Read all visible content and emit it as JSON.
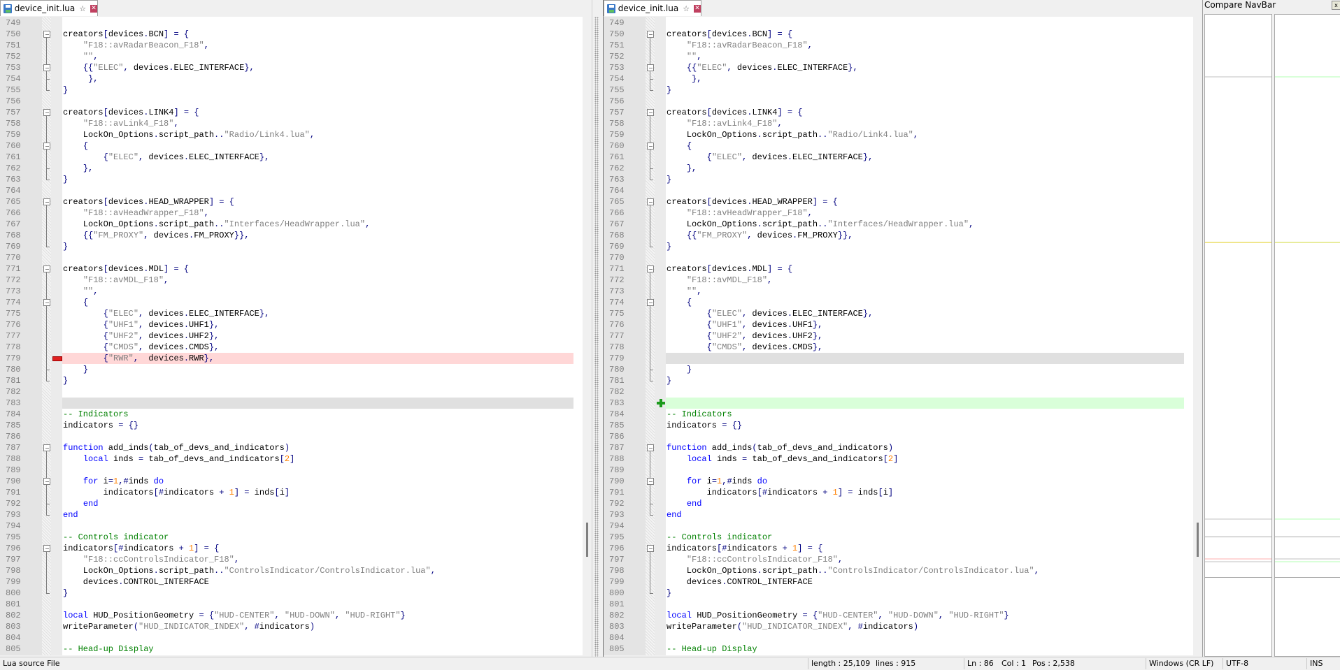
{
  "left": {
    "tab": {
      "title": "device_init.lua",
      "icons": [
        "save-icon",
        "pin-icon",
        "close-icon"
      ]
    },
    "lines": [
      {
        "n": "749",
        "t": ""
      },
      {
        "n": "750",
        "t": "creators[devices.BCN] = {"
      },
      {
        "n": "751",
        "t": "    \"F18::avRadarBeacon_F18\","
      },
      {
        "n": "752",
        "t": "    \"\","
      },
      {
        "n": "753",
        "t": "    {{\"ELEC\", devices.ELEC_INTERFACE},"
      },
      {
        "n": "754",
        "t": "     },"
      },
      {
        "n": "755",
        "t": "}"
      },
      {
        "n": "756",
        "t": ""
      },
      {
        "n": "757",
        "t": "creators[devices.LINK4] = {"
      },
      {
        "n": "758",
        "t": "    \"F18::avLink4_F18\","
      },
      {
        "n": "759",
        "t": "    LockOn_Options.script_path..\"Radio/Link4.lua\","
      },
      {
        "n": "760",
        "t": "    {"
      },
      {
        "n": "761",
        "t": "        {\"ELEC\", devices.ELEC_INTERFACE},"
      },
      {
        "n": "762",
        "t": "    },"
      },
      {
        "n": "763",
        "t": "}"
      },
      {
        "n": "764",
        "t": ""
      },
      {
        "n": "765",
        "t": "creators[devices.HEAD_WRAPPER] = {"
      },
      {
        "n": "766",
        "t": "    \"F18::avHeadWrapper_F18\","
      },
      {
        "n": "767",
        "t": "    LockOn_Options.script_path..\"Interfaces/HeadWrapper.lua\","
      },
      {
        "n": "768",
        "t": "    {{\"FM_PROXY\", devices.FM_PROXY}},"
      },
      {
        "n": "769",
        "t": "}"
      },
      {
        "n": "770",
        "t": ""
      },
      {
        "n": "771",
        "t": "creators[devices.MDL] = {"
      },
      {
        "n": "772",
        "t": "    \"F18::avMDL_F18\","
      },
      {
        "n": "773",
        "t": "    \"\","
      },
      {
        "n": "774",
        "t": "    {"
      },
      {
        "n": "775",
        "t": "        {\"ELEC\", devices.ELEC_INTERFACE},"
      },
      {
        "n": "776",
        "t": "        {\"UHF1\", devices.UHF1},"
      },
      {
        "n": "777",
        "t": "        {\"UHF2\", devices.UHF2},"
      },
      {
        "n": "778",
        "t": "        {\"CMDS\", devices.CMDS},"
      },
      {
        "n": "779",
        "t": "        {\"RWR\",  devices.RWR},",
        "diff": "removed"
      },
      {
        "n": "780",
        "t": "    }"
      },
      {
        "n": "781",
        "t": "}"
      },
      {
        "n": "782",
        "t": ""
      },
      {
        "n": "783",
        "t": "",
        "diff": "blank"
      },
      {
        "n": "784",
        "t": "-- Indicators"
      },
      {
        "n": "785",
        "t": "indicators = {}"
      },
      {
        "n": "786",
        "t": ""
      },
      {
        "n": "787",
        "t": "function add_inds(tab_of_devs_and_indicators)"
      },
      {
        "n": "788",
        "t": "    local inds = tab_of_devs_and_indicators[2]"
      },
      {
        "n": "789",
        "t": ""
      },
      {
        "n": "790",
        "t": "    for i=1,#inds do"
      },
      {
        "n": "791",
        "t": "        indicators[#indicators + 1] = inds[i]"
      },
      {
        "n": "792",
        "t": "    end"
      },
      {
        "n": "793",
        "t": "end"
      },
      {
        "n": "794",
        "t": ""
      },
      {
        "n": "795",
        "t": "-- Controls indicator"
      },
      {
        "n": "796",
        "t": "indicators[#indicators + 1] = {"
      },
      {
        "n": "797",
        "t": "    \"F18::ccControlsIndicator_F18\","
      },
      {
        "n": "798",
        "t": "    LockOn_Options.script_path..\"ControlsIndicator/ControlsIndicator.lua\","
      },
      {
        "n": "799",
        "t": "    devices.CONTROL_INTERFACE"
      },
      {
        "n": "800",
        "t": "}"
      },
      {
        "n": "801",
        "t": ""
      },
      {
        "n": "802",
        "t": "local HUD_PositionGeometry = {\"HUD-CENTER\", \"HUD-DOWN\", \"HUD-RIGHT\"}"
      },
      {
        "n": "803",
        "t": "writeParameter(\"HUD_INDICATOR_INDEX\", #indicators)"
      },
      {
        "n": "804",
        "t": ""
      },
      {
        "n": "805",
        "t": "-- Head-up Display"
      }
    ]
  },
  "right": {
    "tab": {
      "title": "device_init.lua",
      "icons": [
        "save-icon",
        "pin-icon",
        "close-icon"
      ]
    },
    "lines": [
      {
        "n": "749",
        "t": ""
      },
      {
        "n": "750",
        "t": "creators[devices.BCN] = {"
      },
      {
        "n": "751",
        "t": "    \"F18::avRadarBeacon_F18\","
      },
      {
        "n": "752",
        "t": "    \"\","
      },
      {
        "n": "753",
        "t": "    {{\"ELEC\", devices.ELEC_INTERFACE},"
      },
      {
        "n": "754",
        "t": "     },"
      },
      {
        "n": "755",
        "t": "}"
      },
      {
        "n": "756",
        "t": ""
      },
      {
        "n": "757",
        "t": "creators[devices.LINK4] = {"
      },
      {
        "n": "758",
        "t": "    \"F18::avLink4_F18\","
      },
      {
        "n": "759",
        "t": "    LockOn_Options.script_path..\"Radio/Link4.lua\","
      },
      {
        "n": "760",
        "t": "    {"
      },
      {
        "n": "761",
        "t": "        {\"ELEC\", devices.ELEC_INTERFACE},"
      },
      {
        "n": "762",
        "t": "    },"
      },
      {
        "n": "763",
        "t": "}"
      },
      {
        "n": "764",
        "t": ""
      },
      {
        "n": "765",
        "t": "creators[devices.HEAD_WRAPPER] = {"
      },
      {
        "n": "766",
        "t": "    \"F18::avHeadWrapper_F18\","
      },
      {
        "n": "767",
        "t": "    LockOn_Options.script_path..\"Interfaces/HeadWrapper.lua\","
      },
      {
        "n": "768",
        "t": "    {{\"FM_PROXY\", devices.FM_PROXY}},"
      },
      {
        "n": "769",
        "t": "}"
      },
      {
        "n": "770",
        "t": ""
      },
      {
        "n": "771",
        "t": "creators[devices.MDL] = {"
      },
      {
        "n": "772",
        "t": "    \"F18::avMDL_F18\","
      },
      {
        "n": "773",
        "t": "    \"\","
      },
      {
        "n": "774",
        "t": "    {"
      },
      {
        "n": "775",
        "t": "        {\"ELEC\", devices.ELEC_INTERFACE},"
      },
      {
        "n": "776",
        "t": "        {\"UHF1\", devices.UHF1},"
      },
      {
        "n": "777",
        "t": "        {\"UHF2\", devices.UHF2},"
      },
      {
        "n": "778",
        "t": "        {\"CMDS\", devices.CMDS},"
      },
      {
        "n": "779",
        "t": "",
        "diff": "blank"
      },
      {
        "n": "780",
        "t": "    }"
      },
      {
        "n": "781",
        "t": "}"
      },
      {
        "n": "782",
        "t": ""
      },
      {
        "n": "783",
        "t": "",
        "diff": "added"
      },
      {
        "n": "784",
        "t": "-- Indicators"
      },
      {
        "n": "785",
        "t": "indicators = {}"
      },
      {
        "n": "786",
        "t": ""
      },
      {
        "n": "787",
        "t": "function add_inds(tab_of_devs_and_indicators)"
      },
      {
        "n": "788",
        "t": "    local inds = tab_of_devs_and_indicators[2]"
      },
      {
        "n": "789",
        "t": ""
      },
      {
        "n": "790",
        "t": "    for i=1,#inds do"
      },
      {
        "n": "791",
        "t": "        indicators[#indicators + 1] = inds[i]"
      },
      {
        "n": "792",
        "t": "    end"
      },
      {
        "n": "793",
        "t": "end"
      },
      {
        "n": "794",
        "t": ""
      },
      {
        "n": "795",
        "t": "-- Controls indicator"
      },
      {
        "n": "796",
        "t": "indicators[#indicators + 1] = {"
      },
      {
        "n": "797",
        "t": "    \"F18::ccControlsIndicator_F18\","
      },
      {
        "n": "798",
        "t": "    LockOn_Options.script_path..\"ControlsIndicator/ControlsIndicator.lua\","
      },
      {
        "n": "799",
        "t": "    devices.CONTROL_INTERFACE"
      },
      {
        "n": "800",
        "t": "}"
      },
      {
        "n": "801",
        "t": ""
      },
      {
        "n": "802",
        "t": "local HUD_PositionGeometry = {\"HUD-CENTER\", \"HUD-DOWN\", \"HUD-RIGHT\"}"
      },
      {
        "n": "803",
        "t": "writeParameter(\"HUD_INDICATOR_INDEX\", #indicators)"
      },
      {
        "n": "804",
        "t": ""
      },
      {
        "n": "805",
        "t": "-- Head-up Display"
      }
    ]
  },
  "navbar": {
    "title": "Compare NavBar",
    "close": "x"
  },
  "statusbar": {
    "file_type": "Lua source File",
    "length": "length : 25,109",
    "lines": "lines : 915",
    "ln": "Ln : 86",
    "col": "Col : 1",
    "pos": "Pos : 2,538",
    "eol": "Windows (CR LF)",
    "encoding": "UTF-8",
    "mode": "INS"
  },
  "colors": {
    "removed": "#ffd7d7",
    "added": "#d9ffd9",
    "blank": "#e0e0e0",
    "moved": "#f0e68c",
    "keyword": "#0000ff",
    "string": "#808080",
    "number": "#ff8000",
    "comment": "#008000",
    "operator": "#000080"
  }
}
